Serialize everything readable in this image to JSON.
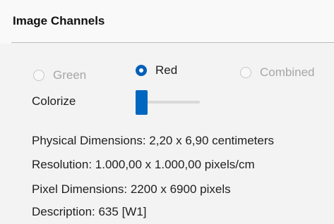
{
  "panel": {
    "title": "Image Channels"
  },
  "channels": {
    "options": [
      {
        "label": "Green",
        "checked": false,
        "enabled": false
      },
      {
        "label": "Red",
        "checked": true,
        "enabled": true
      },
      {
        "label": "Combined",
        "checked": false,
        "enabled": false
      }
    ]
  },
  "colorize": {
    "label": "Colorize",
    "slider_value": 0
  },
  "info": {
    "physical": "Physical Dimensions: 2,20 x 6,90 centimeters",
    "resolution": "Resolution: 1.000,00 x 1.000,00 pixels/cm",
    "pixel": "Pixel Dimensions: 2200 x 6900 pixels",
    "description": "Description: 635 [W1]"
  },
  "colors": {
    "accent": "#005fb8",
    "slider_thumb": "#0067c0",
    "disabled_text": "#a6a6a6"
  }
}
